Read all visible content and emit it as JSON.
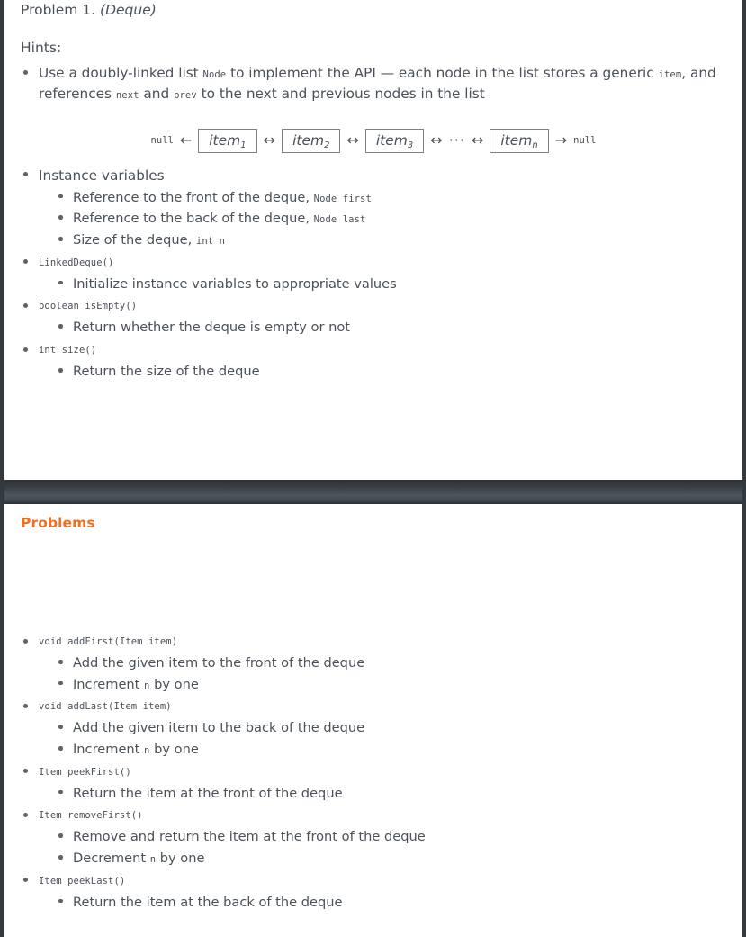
{
  "viewer": {
    "background_color": "#ffffff",
    "chrome_color": "#34393d",
    "divider_color": "#3d4347"
  },
  "slide_1": {
    "heading_prefix": "Problem 1.",
    "heading_emphasis": "(Deque)",
    "hints_label": "Hints:",
    "hint_bullet": {
      "part_1": "Use a doubly-linked list ",
      "code_1": "Node",
      "part_2": " to implement the API — each node in the list stores a generic ",
      "code_2": "item",
      "part_3": ", and references ",
      "code_3": "next",
      "part_4": " and ",
      "code_4": "prev",
      "part_5": " to the next and previous nodes in the list"
    },
    "diagram": {
      "left_null": "null",
      "left_arrow": "←",
      "right_arrow": "→",
      "right_null": "null",
      "bi_arrow": "↔",
      "ellipsis": "···",
      "nodes": [
        {
          "label": "item",
          "subscript": "1"
        },
        {
          "label": "item",
          "subscript": "2"
        },
        {
          "label": "item",
          "subscript": "3"
        },
        {
          "label": "item",
          "subscript": "n"
        }
      ]
    },
    "items": [
      {
        "text": "Instance variables",
        "mono": false,
        "children": [
          {
            "text": "Reference to the front of the deque, ",
            "code": "Node first"
          },
          {
            "text": "Reference to the back of the deque, ",
            "code": "Node last"
          },
          {
            "text": "Size of the deque, ",
            "code": "int n"
          }
        ]
      },
      {
        "text": "LinkedDeque()",
        "mono": true,
        "children": [
          {
            "text": "Initialize instance variables to appropriate values",
            "code": ""
          }
        ]
      },
      {
        "text": "boolean isEmpty()",
        "mono": true,
        "children": [
          {
            "text": "Return whether the deque is empty or not",
            "code": ""
          }
        ]
      },
      {
        "text": "int size()",
        "mono": true,
        "children": [
          {
            "text": "Return the size of the deque",
            "code": ""
          }
        ]
      }
    ]
  },
  "slide_2": {
    "frame_title": "Problems",
    "frame_title_color": "#f07023",
    "items": [
      {
        "text": "void addFirst(Item item)",
        "mono": true,
        "children": [
          {
            "text": "Add the given item to the front of the deque",
            "code": ""
          },
          {
            "text": "Increment ",
            "code": "n",
            "tail": " by one"
          }
        ]
      },
      {
        "text": "void addLast(Item item)",
        "mono": true,
        "children": [
          {
            "text": "Add the given item to the back of the deque",
            "code": ""
          },
          {
            "text": "Increment ",
            "code": "n",
            "tail": " by one"
          }
        ]
      },
      {
        "text": "Item peekFirst()",
        "mono": true,
        "children": [
          {
            "text": "Return the item at the front of the deque",
            "code": ""
          }
        ]
      },
      {
        "text": "Item removeFirst()",
        "mono": true,
        "children": [
          {
            "text": "Remove and return the item at the front of the deque",
            "code": ""
          },
          {
            "text": "Decrement ",
            "code": "n",
            "tail": " by one"
          }
        ]
      },
      {
        "text": "Item peekLast()",
        "mono": true,
        "children": [
          {
            "text": "Return the item at the back of the deque",
            "code": ""
          }
        ]
      }
    ]
  }
}
